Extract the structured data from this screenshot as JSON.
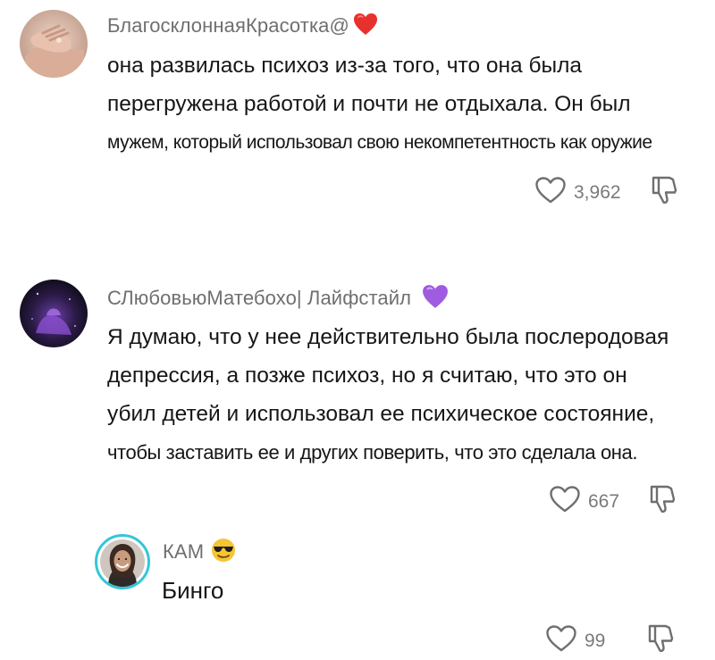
{
  "comments": [
    {
      "username": "БлагосклоннаяКрасотка@",
      "username_emoji": "red-heart-emoji",
      "text_lines": [
        "она развилась психоз из-за того, что она была",
        "перегружена работой и почти не отдыхала. Он был",
        "мужем, который использовал свою некомпетентность как оружие"
      ],
      "like_count": "3,962",
      "avatar": "hands-photo-avatar"
    },
    {
      "username": "СЛюбовьюМатебохо| Лайфстайл",
      "username_emoji": "purple-heart-emoji",
      "text_lines": [
        "Я думаю, что у нее действительно была послеродовая",
        "депрессия, а позже психоз, но я считаю, что это он",
        "убил детей и использовал ее психическое состояние,",
        "чтобы заставить ее и других поверить, что это сделала она."
      ],
      "like_count": "667",
      "avatar": "purple-night-avatar"
    }
  ],
  "reply": {
    "username": "КАМ",
    "username_emoji": "sunglasses-emoji",
    "text": "Бинго",
    "like_count": "99",
    "avatar": "woman-portrait-avatar"
  },
  "icons": {
    "like": "heart-outline-icon",
    "dislike": "thumbs-down-icon"
  },
  "colors": {
    "text": "#161616",
    "username": "#6f6f6f",
    "count": "#7a7a7a",
    "red_heart": "#e8302f",
    "purple_heart": "#a05ce0",
    "story_ring": "#33c6d9"
  }
}
